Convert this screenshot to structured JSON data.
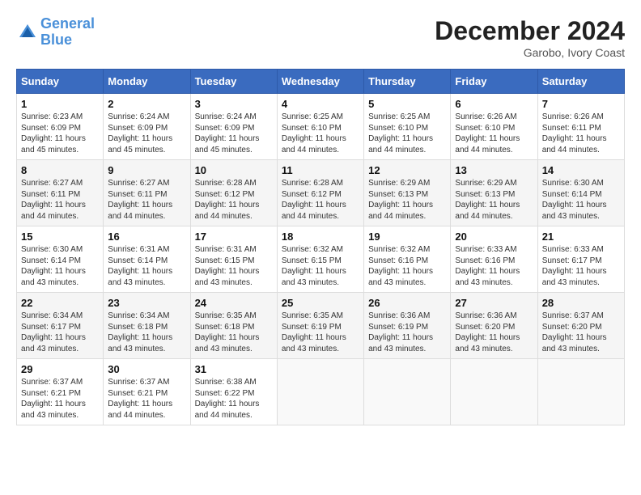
{
  "header": {
    "logo_line1": "General",
    "logo_line2": "Blue",
    "month": "December 2024",
    "location": "Garobo, Ivory Coast"
  },
  "days_of_week": [
    "Sunday",
    "Monday",
    "Tuesday",
    "Wednesday",
    "Thursday",
    "Friday",
    "Saturday"
  ],
  "weeks": [
    [
      {
        "day": "1",
        "sunrise": "6:23 AM",
        "sunset": "6:09 PM",
        "daylight": "11 hours and 45 minutes."
      },
      {
        "day": "2",
        "sunrise": "6:24 AM",
        "sunset": "6:09 PM",
        "daylight": "11 hours and 45 minutes."
      },
      {
        "day": "3",
        "sunrise": "6:24 AM",
        "sunset": "6:09 PM",
        "daylight": "11 hours and 45 minutes."
      },
      {
        "day": "4",
        "sunrise": "6:25 AM",
        "sunset": "6:10 PM",
        "daylight": "11 hours and 44 minutes."
      },
      {
        "day": "5",
        "sunrise": "6:25 AM",
        "sunset": "6:10 PM",
        "daylight": "11 hours and 44 minutes."
      },
      {
        "day": "6",
        "sunrise": "6:26 AM",
        "sunset": "6:10 PM",
        "daylight": "11 hours and 44 minutes."
      },
      {
        "day": "7",
        "sunrise": "6:26 AM",
        "sunset": "6:11 PM",
        "daylight": "11 hours and 44 minutes."
      }
    ],
    [
      {
        "day": "8",
        "sunrise": "6:27 AM",
        "sunset": "6:11 PM",
        "daylight": "11 hours and 44 minutes."
      },
      {
        "day": "9",
        "sunrise": "6:27 AM",
        "sunset": "6:11 PM",
        "daylight": "11 hours and 44 minutes."
      },
      {
        "day": "10",
        "sunrise": "6:28 AM",
        "sunset": "6:12 PM",
        "daylight": "11 hours and 44 minutes."
      },
      {
        "day": "11",
        "sunrise": "6:28 AM",
        "sunset": "6:12 PM",
        "daylight": "11 hours and 44 minutes."
      },
      {
        "day": "12",
        "sunrise": "6:29 AM",
        "sunset": "6:13 PM",
        "daylight": "11 hours and 44 minutes."
      },
      {
        "day": "13",
        "sunrise": "6:29 AM",
        "sunset": "6:13 PM",
        "daylight": "11 hours and 44 minutes."
      },
      {
        "day": "14",
        "sunrise": "6:30 AM",
        "sunset": "6:14 PM",
        "daylight": "11 hours and 43 minutes."
      }
    ],
    [
      {
        "day": "15",
        "sunrise": "6:30 AM",
        "sunset": "6:14 PM",
        "daylight": "11 hours and 43 minutes."
      },
      {
        "day": "16",
        "sunrise": "6:31 AM",
        "sunset": "6:14 PM",
        "daylight": "11 hours and 43 minutes."
      },
      {
        "day": "17",
        "sunrise": "6:31 AM",
        "sunset": "6:15 PM",
        "daylight": "11 hours and 43 minutes."
      },
      {
        "day": "18",
        "sunrise": "6:32 AM",
        "sunset": "6:15 PM",
        "daylight": "11 hours and 43 minutes."
      },
      {
        "day": "19",
        "sunrise": "6:32 AM",
        "sunset": "6:16 PM",
        "daylight": "11 hours and 43 minutes."
      },
      {
        "day": "20",
        "sunrise": "6:33 AM",
        "sunset": "6:16 PM",
        "daylight": "11 hours and 43 minutes."
      },
      {
        "day": "21",
        "sunrise": "6:33 AM",
        "sunset": "6:17 PM",
        "daylight": "11 hours and 43 minutes."
      }
    ],
    [
      {
        "day": "22",
        "sunrise": "6:34 AM",
        "sunset": "6:17 PM",
        "daylight": "11 hours and 43 minutes."
      },
      {
        "day": "23",
        "sunrise": "6:34 AM",
        "sunset": "6:18 PM",
        "daylight": "11 hours and 43 minutes."
      },
      {
        "day": "24",
        "sunrise": "6:35 AM",
        "sunset": "6:18 PM",
        "daylight": "11 hours and 43 minutes."
      },
      {
        "day": "25",
        "sunrise": "6:35 AM",
        "sunset": "6:19 PM",
        "daylight": "11 hours and 43 minutes."
      },
      {
        "day": "26",
        "sunrise": "6:36 AM",
        "sunset": "6:19 PM",
        "daylight": "11 hours and 43 minutes."
      },
      {
        "day": "27",
        "sunrise": "6:36 AM",
        "sunset": "6:20 PM",
        "daylight": "11 hours and 43 minutes."
      },
      {
        "day": "28",
        "sunrise": "6:37 AM",
        "sunset": "6:20 PM",
        "daylight": "11 hours and 43 minutes."
      }
    ],
    [
      {
        "day": "29",
        "sunrise": "6:37 AM",
        "sunset": "6:21 PM",
        "daylight": "11 hours and 43 minutes."
      },
      {
        "day": "30",
        "sunrise": "6:37 AM",
        "sunset": "6:21 PM",
        "daylight": "11 hours and 44 minutes."
      },
      {
        "day": "31",
        "sunrise": "6:38 AM",
        "sunset": "6:22 PM",
        "daylight": "11 hours and 44 minutes."
      },
      null,
      null,
      null,
      null
    ]
  ]
}
